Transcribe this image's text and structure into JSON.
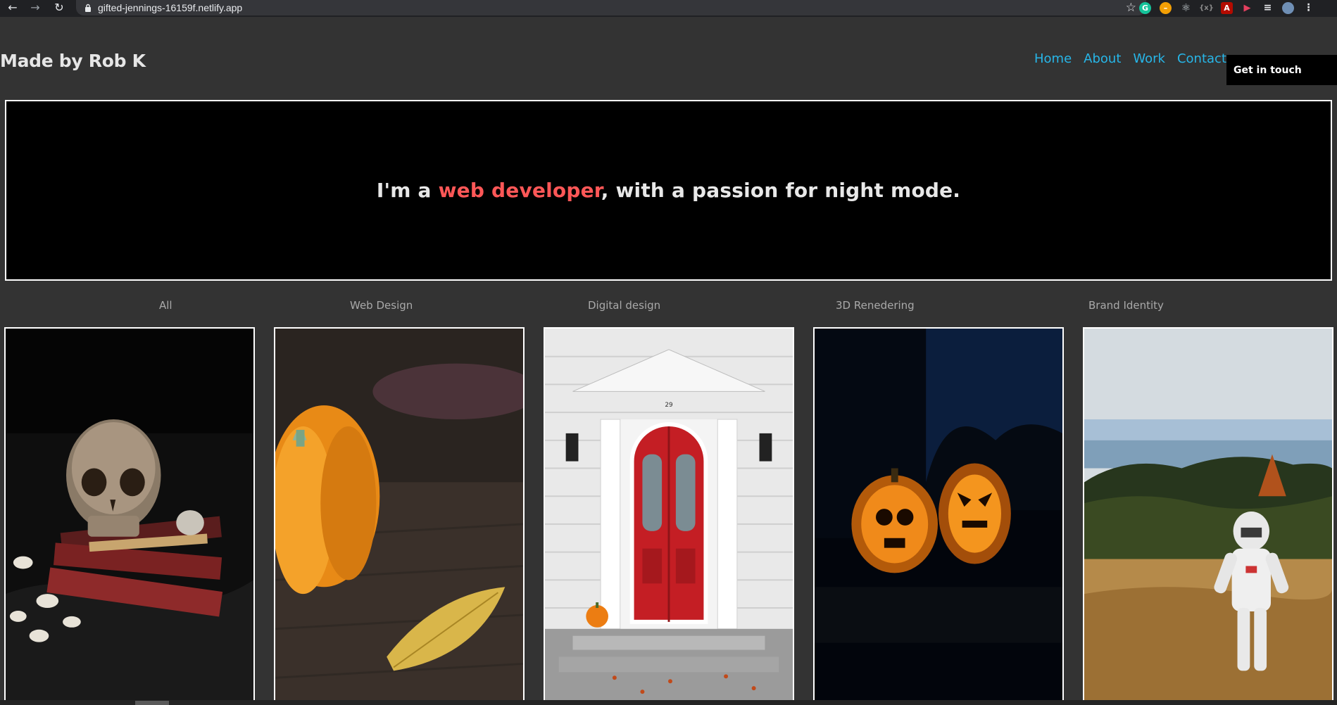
{
  "browser": {
    "url": "gifted-jennings-16159f.netlify.app"
  },
  "site": {
    "brand": "Made by Rob K",
    "nav": [
      {
        "label": "Home"
      },
      {
        "label": "About"
      },
      {
        "label": "Work"
      },
      {
        "label": "Contact"
      }
    ],
    "cta_label": "Get in touch",
    "accent_color": "#ff5757",
    "nav_color": "#27b6e8"
  },
  "hero": {
    "prefix": "I'm a ",
    "highlight": "web developer",
    "suffix": ", with a passion for night mode."
  },
  "filters": [
    {
      "label": "All"
    },
    {
      "label": "Web Design"
    },
    {
      "label": "Digital design"
    },
    {
      "label": "3D Renedering"
    },
    {
      "label": "Brand Identity"
    }
  ],
  "gallery": [
    {
      "subject": "skull-with-books-photo"
    },
    {
      "subject": "pumpkin-and-leaf-photo"
    },
    {
      "subject": "red-door-photo"
    },
    {
      "subject": "jack-o-lanterns-photo"
    },
    {
      "subject": "astronaut-figure-photo"
    }
  ],
  "door_number": "29"
}
